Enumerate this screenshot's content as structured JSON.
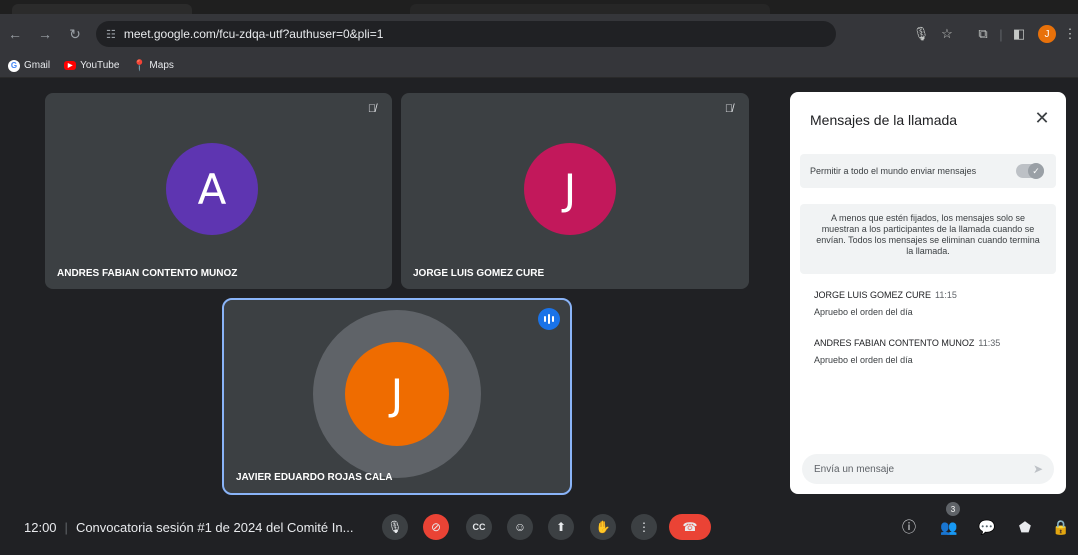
{
  "browser": {
    "url": "meet.google.com/fcu-zdqa-utf?authuser=0&pli=1",
    "profile_initial": "J",
    "bookmarks": [
      {
        "label": "Gmail"
      },
      {
        "label": "YouTube"
      },
      {
        "label": "Maps"
      }
    ]
  },
  "participants": [
    {
      "name": "ANDRES FABIAN CONTENTO MUNOZ",
      "initial": "A",
      "color": "#5e35b1",
      "muted": true,
      "speaking": false
    },
    {
      "name": "JORGE LUIS GOMEZ CURE",
      "initial": "J",
      "color": "#c2185b",
      "muted": true,
      "speaking": false
    },
    {
      "name": "JAVIER EDUARDO ROJAS CALA",
      "initial": "J",
      "color": "#ef6c00",
      "muted": false,
      "speaking": true
    }
  ],
  "chat": {
    "title": "Mensajes de la llamada",
    "toggle_label": "Permitir a todo el mundo enviar mensajes",
    "toggle_on": true,
    "info": "A menos que estén fijados, los mensajes solo se muestran a los participantes de la llamada cuando se envían. Todos los mensajes se eliminan cuando termina la llamada.",
    "messages": [
      {
        "sender": "JORGE LUIS GOMEZ CURE",
        "time": "11:15",
        "text": "Apruebo el orden del día"
      },
      {
        "sender": "ANDRES FABIAN CONTENTO MUNOZ",
        "time": "11:35",
        "text": "Apruebo el orden del día"
      }
    ],
    "input_placeholder": "Envía un mensaje"
  },
  "meeting": {
    "time": "12:00",
    "title": "Convocatoria sesión #1 de 2024 del Comité In...",
    "participant_count": "3"
  },
  "colors": {
    "accent": "#8ab4f8",
    "hangup": "#ea4335",
    "chat_active": "#8ab4f8"
  }
}
